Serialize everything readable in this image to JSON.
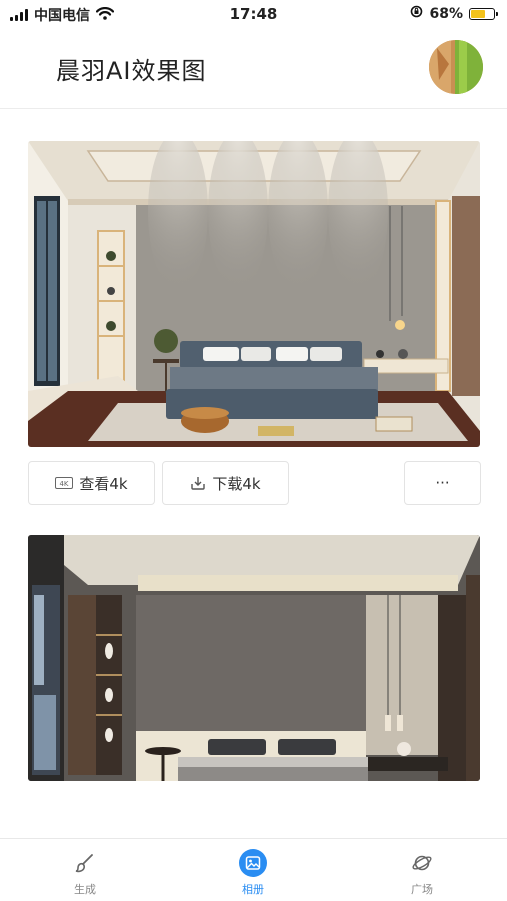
{
  "status_bar": {
    "carrier": "中国电信",
    "time": "17:48",
    "battery": "68%",
    "battery_level": 0.68
  },
  "header": {
    "title": "晨羽AI效果图"
  },
  "actions": {
    "view4k": "查看4k",
    "download4k": "下载4k",
    "more": "···"
  },
  "tabs": [
    {
      "label": "生成",
      "icon": "brush-icon",
      "active": false
    },
    {
      "label": "相册",
      "icon": "album-icon",
      "active": true
    },
    {
      "label": "广场",
      "icon": "planet-icon",
      "active": false
    }
  ],
  "colors": {
    "accent": "#2a8df2",
    "battery": "#f3c21b"
  }
}
